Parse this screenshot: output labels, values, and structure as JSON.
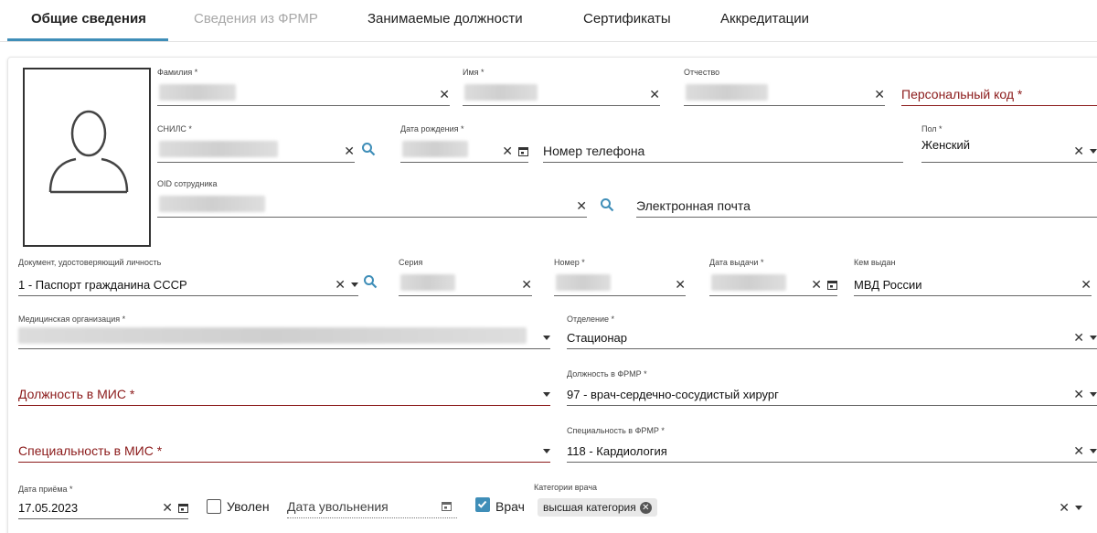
{
  "tabs": [
    {
      "label": "Общие сведения",
      "state": "active"
    },
    {
      "label": "Сведения из ФРМР",
      "state": "disabled"
    },
    {
      "label": "Занимаемые должности",
      "state": "normal"
    },
    {
      "label": "Сертификаты",
      "state": "normal"
    },
    {
      "label": "Аккредитации",
      "state": "normal"
    }
  ],
  "colors": {
    "accent": "#3f8eb8",
    "required": "#8b1a1a"
  },
  "photo": {
    "icon": "user-avatar-icon"
  },
  "fields": {
    "surname": {
      "label": "Фамилия *"
    },
    "name": {
      "label": "Имя *"
    },
    "patronymic": {
      "label": "Отчество"
    },
    "personal_code": {
      "placeholder": "Персональный код *"
    },
    "snils": {
      "label": "СНИЛС *"
    },
    "birth_date": {
      "label": "Дата рождения *"
    },
    "phone": {
      "placeholder": "Номер телефона"
    },
    "gender": {
      "label": "Пол *",
      "value": "Женский"
    },
    "oid": {
      "label": "OID сотрудника"
    },
    "email": {
      "placeholder": "Электронная почта"
    },
    "id_document": {
      "label": "Документ, удостоверяющий личность",
      "value": "1 - Паспорт гражданина СССР"
    },
    "series": {
      "label": "Серия"
    },
    "number": {
      "label": "Номер *"
    },
    "issue_date": {
      "label": "Дата выдачи *"
    },
    "issued_by": {
      "label": "Кем выдан",
      "value": "МВД России"
    },
    "med_org": {
      "label": "Медицинская организация *"
    },
    "department": {
      "label": "Отделение *",
      "value": "Стационар"
    },
    "position_mis": {
      "placeholder": "Должность в МИС *"
    },
    "position_frmr": {
      "label": "Должность в ФРМР *",
      "value": "97 - врач-сердечно-сосудистый хирург"
    },
    "specialty_mis": {
      "placeholder": "Специальность в МИС *"
    },
    "specialty_frmr": {
      "label": "Специальность в ФРМР *",
      "value": "118 - Кардиология"
    },
    "hire_date": {
      "label": "Дата приёма *",
      "value": "17.05.2023"
    },
    "dismissed": {
      "label": "Уволен",
      "checked": false
    },
    "dismissal_date": {
      "placeholder": "Дата увольнения"
    },
    "doctor": {
      "label": "Врач",
      "checked": true
    },
    "doctor_category": {
      "label": "Категории врача",
      "chip": "высшая категория"
    }
  }
}
